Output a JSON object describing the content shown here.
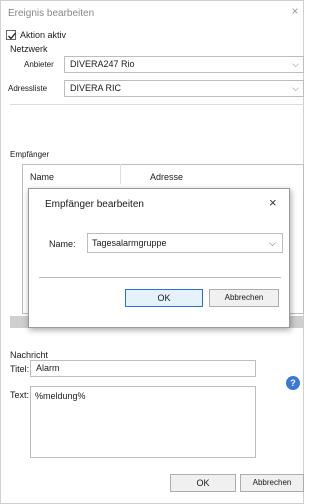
{
  "window": {
    "title": "Ereignis bearbeiten",
    "close": "×"
  },
  "action": {
    "label": "Aktion aktiv",
    "checked": true
  },
  "network": {
    "heading": "Netzwerk",
    "provider_label": "Anbieter",
    "provider_value": "DIVERA247 Rio",
    "address_label": "Adressliste",
    "address_value": "DIVERA RIC"
  },
  "recipients": {
    "heading": "Empfänger",
    "col_name": "Name",
    "col_address": "Adresse"
  },
  "dialog": {
    "title": "Empfänger bearbeiten",
    "close": "×",
    "name_label": "Name:",
    "name_value": "Tagesalarmgruppe",
    "ok": "OK",
    "cancel": "Abbrechen"
  },
  "message": {
    "heading": "Nachricht",
    "title_label": "Titel:",
    "title_value": "Alarm",
    "text_label": "Text:",
    "text_value": "%meldung%"
  },
  "footer": {
    "ok": "OK",
    "cancel": "Abbrechen"
  },
  "icons": {
    "info": "?"
  },
  "colors": {
    "accent": "#2b6fd6",
    "info": "#3a78d8"
  }
}
